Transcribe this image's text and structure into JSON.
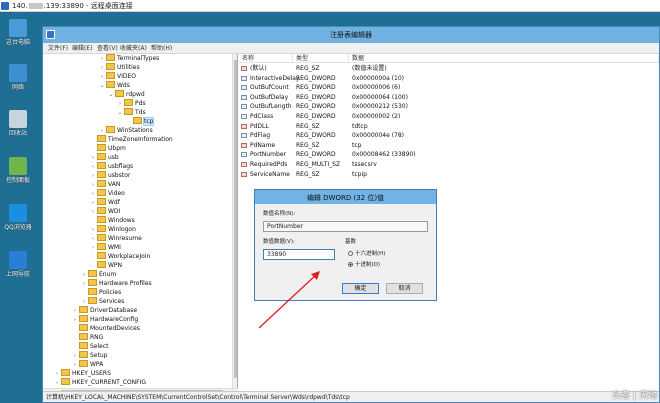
{
  "rdp_window": {
    "title_prefix": "140.",
    "title_suffix": ".139:33890 - 远程桌面连接"
  },
  "desktop": {
    "icons": [
      {
        "label": "这台电脑",
        "icon": "computer-icon",
        "color": "#4a9ad6"
      },
      {
        "label": "网络",
        "icon": "network-icon",
        "color": "#3d8fd0"
      },
      {
        "label": "回收站",
        "icon": "recycle-bin-icon",
        "color": "#c8d4dc"
      },
      {
        "label": "控制面板",
        "icon": "control-panel-icon",
        "color": "#6fb54a"
      },
      {
        "label": "QQ浏览器",
        "icon": "qq-browser-icon",
        "color": "#1a8fe0"
      },
      {
        "label": "上网导航",
        "icon": "ie-icon",
        "color": "#2a7fd4"
      }
    ]
  },
  "regedit": {
    "title": "注册表编辑器",
    "menu": [
      "文件(F)",
      "编辑(E)",
      "查看(V)",
      "收藏夹(A)",
      "帮助(H)"
    ],
    "tree": [
      {
        "label": "TerminalTypes",
        "indent": 6,
        "exp": "›",
        "selected": false
      },
      {
        "label": "Utilities",
        "indent": 6,
        "exp": "›",
        "selected": false
      },
      {
        "label": "VIDEO",
        "indent": 6,
        "exp": "›",
        "selected": false
      },
      {
        "label": "Wds",
        "indent": 6,
        "exp": "⌄",
        "selected": false
      },
      {
        "label": "rdpwd",
        "indent": 7,
        "exp": "⌄",
        "selected": false
      },
      {
        "label": "Pds",
        "indent": 8,
        "exp": "›",
        "selected": false
      },
      {
        "label": "Tds",
        "indent": 8,
        "exp": "⌄",
        "selected": false
      },
      {
        "label": "tcp",
        "indent": 9,
        "exp": "",
        "selected": true
      },
      {
        "label": "WinStations",
        "indent": 6,
        "exp": "›",
        "selected": false
      },
      {
        "label": "TimeZoneInformation",
        "indent": 5,
        "exp": "",
        "selected": false
      },
      {
        "label": "Ubpm",
        "indent": 5,
        "exp": "",
        "selected": false
      },
      {
        "label": "usb",
        "indent": 5,
        "exp": "›",
        "selected": false
      },
      {
        "label": "usbflags",
        "indent": 5,
        "exp": "›",
        "selected": false
      },
      {
        "label": "usbstor",
        "indent": 5,
        "exp": "›",
        "selected": false
      },
      {
        "label": "VAN",
        "indent": 5,
        "exp": "›",
        "selected": false
      },
      {
        "label": "Video",
        "indent": 5,
        "exp": "›",
        "selected": false
      },
      {
        "label": "Wdf",
        "indent": 5,
        "exp": "›",
        "selected": false
      },
      {
        "label": "WDI",
        "indent": 5,
        "exp": "›",
        "selected": false
      },
      {
        "label": "Windows",
        "indent": 5,
        "exp": "",
        "selected": false
      },
      {
        "label": "Winlogon",
        "indent": 5,
        "exp": "›",
        "selected": false
      },
      {
        "label": "Winresume",
        "indent": 5,
        "exp": "›",
        "selected": false
      },
      {
        "label": "WMI",
        "indent": 5,
        "exp": "›",
        "selected": false
      },
      {
        "label": "WorkplaceJoin",
        "indent": 5,
        "exp": "",
        "selected": false
      },
      {
        "label": "WPN",
        "indent": 5,
        "exp": "",
        "selected": false
      },
      {
        "label": "Enum",
        "indent": 4,
        "exp": "›",
        "selected": false
      },
      {
        "label": "Hardware Profiles",
        "indent": 4,
        "exp": "›",
        "selected": false
      },
      {
        "label": "Policies",
        "indent": 4,
        "exp": "",
        "selected": false
      },
      {
        "label": "Services",
        "indent": 4,
        "exp": "›",
        "selected": false
      },
      {
        "label": "DriverDatabase",
        "indent": 3,
        "exp": "›",
        "selected": false
      },
      {
        "label": "HardwareConfig",
        "indent": 3,
        "exp": "›",
        "selected": false
      },
      {
        "label": "MountedDevices",
        "indent": 3,
        "exp": "",
        "selected": false
      },
      {
        "label": "RNG",
        "indent": 3,
        "exp": "",
        "selected": false
      },
      {
        "label": "Select",
        "indent": 3,
        "exp": "",
        "selected": false
      },
      {
        "label": "Setup",
        "indent": 3,
        "exp": "›",
        "selected": false
      },
      {
        "label": "WPA",
        "indent": 3,
        "exp": "›",
        "selected": false
      },
      {
        "label": "HKEY_USERS",
        "indent": 1,
        "exp": "›",
        "selected": false
      },
      {
        "label": "HKEY_CURRENT_CONFIG",
        "indent": 1,
        "exp": "›",
        "selected": false
      }
    ],
    "columns": [
      "名称",
      "类型",
      "数据"
    ],
    "values": [
      {
        "name": "(默认)",
        "type": "REG_SZ",
        "data": "(数值未设置)",
        "kind": "str"
      },
      {
        "name": "InteractiveDelay",
        "type": "REG_DWORD",
        "data": "0x0000000a (10)",
        "kind": "bin"
      },
      {
        "name": "OutBufCount",
        "type": "REG_DWORD",
        "data": "0x00000006 (6)",
        "kind": "bin"
      },
      {
        "name": "OutBufDelay",
        "type": "REG_DWORD",
        "data": "0x00000064 (100)",
        "kind": "bin"
      },
      {
        "name": "OutBufLength",
        "type": "REG_DWORD",
        "data": "0x00000212 (530)",
        "kind": "bin"
      },
      {
        "name": "PdClass",
        "type": "REG_DWORD",
        "data": "0x00000002 (2)",
        "kind": "bin"
      },
      {
        "name": "PdDLL",
        "type": "REG_SZ",
        "data": "tdtcp",
        "kind": "str"
      },
      {
        "name": "PdFlag",
        "type": "REG_DWORD",
        "data": "0x0000004e (78)",
        "kind": "bin"
      },
      {
        "name": "PdName",
        "type": "REG_SZ",
        "data": "tcp",
        "kind": "str"
      },
      {
        "name": "PortNumber",
        "type": "REG_DWORD",
        "data": "0x00008462 (33890)",
        "kind": "bin"
      },
      {
        "name": "RequiredPds",
        "type": "REG_MULTI_SZ",
        "data": "tssecsrv",
        "kind": "str"
      },
      {
        "name": "ServiceName",
        "type": "REG_SZ",
        "data": "tcpip",
        "kind": "str"
      }
    ],
    "status_path": "计算机\\HKEY_LOCAL_MACHINE\\SYSTEM\\CurrentControlSet\\Control\\Terminal Server\\Wds\\rdpwd\\Tds\\tcp"
  },
  "dialog": {
    "title": "编辑 DWORD (32 位)值",
    "name_label": "数值名称(N):",
    "name_value": "PortNumber",
    "data_label": "数值数据(V):",
    "data_value": "33890",
    "base_label": "基数",
    "radio_hex": "十六进制(H)",
    "radio_dec": "十进制(D)",
    "ok": "确定",
    "cancel": "取消"
  },
  "watermark": "头条 | 天地"
}
